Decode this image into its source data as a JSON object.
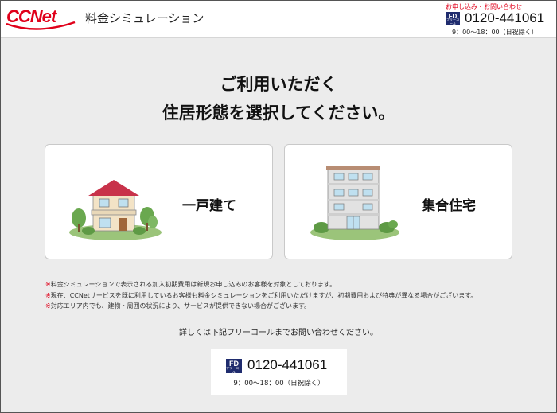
{
  "header": {
    "logo_text": "CCNet",
    "title": "料金シミュレーション",
    "contact_caption": "お申し込み・お問い合わせ",
    "freedial_badge": "FD",
    "freedial_sub": "フリーコール",
    "phone": "0120-441061",
    "hours": "9：00〜18：00（日祝除く）"
  },
  "main": {
    "heading_line1": "ご利用いただく",
    "heading_line2": "住居形態を選択してください。",
    "options": [
      {
        "label": "一戸建て",
        "icon": "house-icon"
      },
      {
        "label": "集合住宅",
        "icon": "apartment-building-icon"
      }
    ]
  },
  "notes": [
    {
      "mark": "※",
      "text": "料金シミュレーションで表示される加入初期費用は新規お申し込みのお客様を対象としております。"
    },
    {
      "mark": "※",
      "text": "現在、CCNetサービスを既に利用しているお客様も料金シミュレーションをご利用いただけますが、初期費用および特典が異なる場合がございます。"
    },
    {
      "mark": "※",
      "text": "対応エリア内でも、建物・周囲の状況により、サービスが提供できない場合がございます。"
    }
  ],
  "contact": {
    "lead": "詳しくは下記フリーコールまでお問い合わせください。",
    "freedial_badge": "FD",
    "freedial_sub": "フリーコール",
    "phone": "0120-441061",
    "hours": "9：00〜18：00（日祝除く）"
  },
  "colors": {
    "brand_red": "#e0001a",
    "freedial_navy": "#1f2c6e",
    "background": "#ececec"
  }
}
